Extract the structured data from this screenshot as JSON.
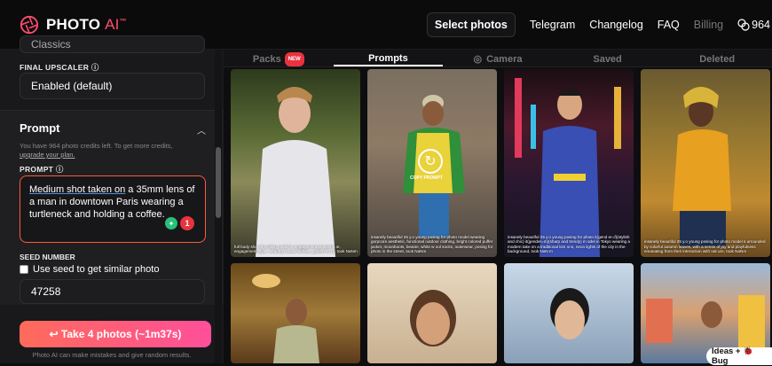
{
  "brand": {
    "name": "PHOTO",
    "ai": "AI",
    "tm": "™"
  },
  "nav": {
    "select_photos": "Select photos",
    "telegram": "Telegram",
    "changelog": "Changelog",
    "faq": "FAQ",
    "billing": "Billing",
    "credits": "964"
  },
  "sidebar": {
    "truncated_field": "Classics",
    "upscaler_label": "FINAL UPSCALER ⓘ",
    "upscaler_value": "Enabled (default)",
    "prompt_title": "Prompt",
    "credits_hint": "You have 964 photo credits left. To get more credits,",
    "upgrade_link": "upgrade your plan.",
    "prompt_label": "PROMPT ⓘ",
    "prompt_ul": "Medium shot taken on",
    "prompt_rest": " a 35mm lens of a man in downtown Paris wearing a turtleneck and holding a coffee.",
    "alert_count": "1",
    "seed_label": "SEED NUMBER",
    "seed_checkbox": "Use seed to get similar photo",
    "seed_value": "47258",
    "cta": "↩ Take 4 photos (~1m37s)",
    "footnote": "Photo AI can make mistakes and give random results."
  },
  "tabs": [
    {
      "label": "Packs",
      "badge": "NEW"
    },
    {
      "label": "Prompts"
    },
    {
      "label": "Camera"
    },
    {
      "label": "Saved"
    },
    {
      "label": "Deleted"
    }
  ],
  "cards": [
    {
      "caption": "full body shot of smiling model in engagement photosho ot, engagement style, wearing casual clothes, golden ho ur, took NaNm"
    },
    {
      "caption": "insanely beautiful 25 y.o young posing for photo model wearing gorpcore aesthetic, functional outdoor clothing, bright colored puffer jacket, moonboots, beanie, white w ool socks, outerwear, posing for photo in the street, took NaNm",
      "copy": "COPY PROMPT"
    },
    {
      "caption": "insanely beautiful 25 y.o young posing for photo it(gend er=f)(stylish and chic) it(gender=m)(sharp and trendy) m odel in Tokyo wearing a modern take on a traditional kim ono, neon lights of the city in the background, took NaN m"
    },
    {
      "caption": "insanely beautiful 25 y.o young posing for photo model s urrounded by colorful autumn leaves, with a sense of joy and playfulness emanating from their interaction with nat ure, took NaNm"
    }
  ],
  "chip": "Ideas + 🐞 Bug",
  "colors": {
    "accent": "#ff4d6d",
    "cta_start": "#ff6b5b",
    "cta_end": "#ff4f9a",
    "danger": "#e8333f",
    "success": "#29c07a"
  }
}
